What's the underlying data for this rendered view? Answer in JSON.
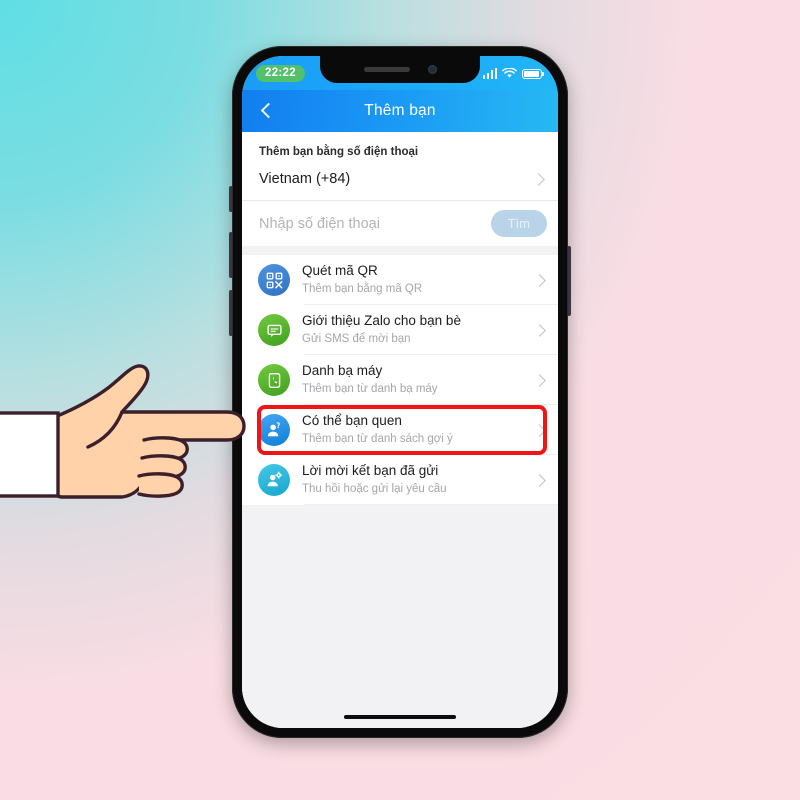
{
  "background": {
    "gradient_from": "#5FDEE4",
    "gradient_to": "#FBDCE3"
  },
  "device": {
    "frame_color": "#0a0a0a",
    "screen_bg": "#f2f2f4",
    "notch": {
      "speaker_name": "earpiece-speaker",
      "camera_name": "front-camera"
    },
    "home_indicator": "home-indicator"
  },
  "status_bar": {
    "time": "22:22",
    "time_pill_color": "#53c16b",
    "signal_icon": "cellular-signal-icon",
    "wifi_icon": "wifi-icon",
    "battery_icon": "battery-icon"
  },
  "app_bar": {
    "title": "Thêm bạn",
    "back_icon": "back-chevron-icon",
    "bg_from": "#127ef0",
    "bg_to": "#27b9f3"
  },
  "phone_section": {
    "label": "Thêm bạn bằng số điện thoại",
    "country": {
      "name": "Vietnam (+84)",
      "chevron_icon": "chevron-right-icon"
    },
    "phone_input": {
      "value": "",
      "placeholder": "Nhập số điện thoại"
    },
    "find_button": {
      "label": "Tìm",
      "color": "#b9d3e8",
      "enabled": false
    }
  },
  "options": [
    {
      "id": "quet-ma-qr",
      "title": "Quét mã QR",
      "subtitle": "Thêm bạn bằng mã QR",
      "icon": "qr-code-icon",
      "icon_color": "#3c84d8",
      "chevron_icon": "chevron-right-icon",
      "highlighted": false
    },
    {
      "id": "gioi-thieu-zalo",
      "title": "Giới thiệu Zalo cho bạn bè",
      "subtitle": "Gửi SMS để mời bạn",
      "icon": "sms-message-icon",
      "icon_color": "#4cb game",
      "highlighted": false,
      "chevron_icon": "chevron-right-icon"
    },
    {
      "id": "danh-ba-may",
      "title": "Danh bạ máy",
      "subtitle": "Thêm bạn từ danh bạ máy",
      "icon": "phone-contacts-icon",
      "icon_color": "#4cbb3a",
      "chevron_icon": "chevron-right-icon",
      "highlighted": false
    },
    {
      "id": "co-the-ban-quen",
      "title": "Có thể bạn quen",
      "subtitle": "Thêm bạn từ danh sách gợi ý",
      "icon": "person-question-icon",
      "icon_color": "#2196f3",
      "chevron_icon": "chevron-right-icon",
      "highlighted": true
    },
    {
      "id": "loi-moi-ket-ban",
      "title": "Lời mời kết bạn đã gửi",
      "subtitle": "Thu hồi hoặc gửi lại yêu cầu",
      "icon": "person-gear-icon",
      "icon_color": "#29b6d8",
      "chevron_icon": "chevron-right-icon",
      "highlighted": false
    }
  ],
  "highlight": {
    "target": "co-the-ban-quen",
    "border_color": "#f01414"
  },
  "pointer": {
    "icon": "pointing-hand-icon",
    "skin_color": "#ffd2aa",
    "outline_color": "#3b1f2b",
    "cuff_color": "#ffffff"
  }
}
